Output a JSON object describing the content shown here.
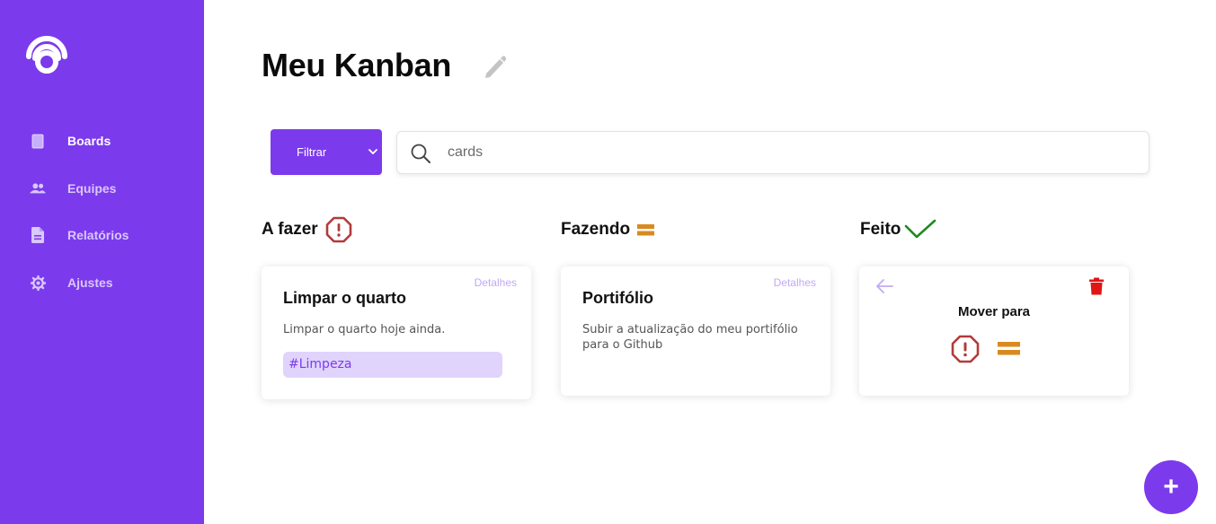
{
  "sidebar": {
    "logo": "app-logo",
    "items": [
      {
        "label": "Boards",
        "icon": "board-icon",
        "active": true
      },
      {
        "label": "Equipes",
        "icon": "team-icon"
      },
      {
        "label": "Relatórios",
        "icon": "report-icon"
      },
      {
        "label": "Ajustes",
        "icon": "gear-icon"
      }
    ],
    "color": "#7c3aed"
  },
  "header": {
    "title": "Meu Kanban",
    "edit_icon": "pencil-icon"
  },
  "toolbar": {
    "filter_label": "Filtrar",
    "search_placeholder": "cards",
    "search_icon": "search-icon"
  },
  "columns": [
    {
      "title": "A fazer",
      "status_icon": "alert-octagon-icon",
      "cards": [
        {
          "title": "Limpar o quarto",
          "details": "Detalhes",
          "description": "Limpar o quarto hoje ainda.",
          "tag": "#Limpeza"
        }
      ]
    },
    {
      "title": "Fazendo",
      "status_icon": "equals-icon",
      "cards": [
        {
          "title": "Portifólio",
          "details": "Detalhes",
          "description": "Subir a atualização do meu portifólio para o Github"
        }
      ]
    },
    {
      "title": "Feito",
      "status_icon": "check-icon",
      "cards": [
        {
          "move_label": "Mover para",
          "back_icon": "arrow-left-icon",
          "delete_icon": "trash-icon"
        }
      ]
    }
  ],
  "fab": {
    "label": "+"
  },
  "colors": {
    "accent": "#7c3aed",
    "todo": "#b43a3a",
    "doing": "#d98a1e",
    "done": "#1f8a1f",
    "delete": "#e01515"
  }
}
